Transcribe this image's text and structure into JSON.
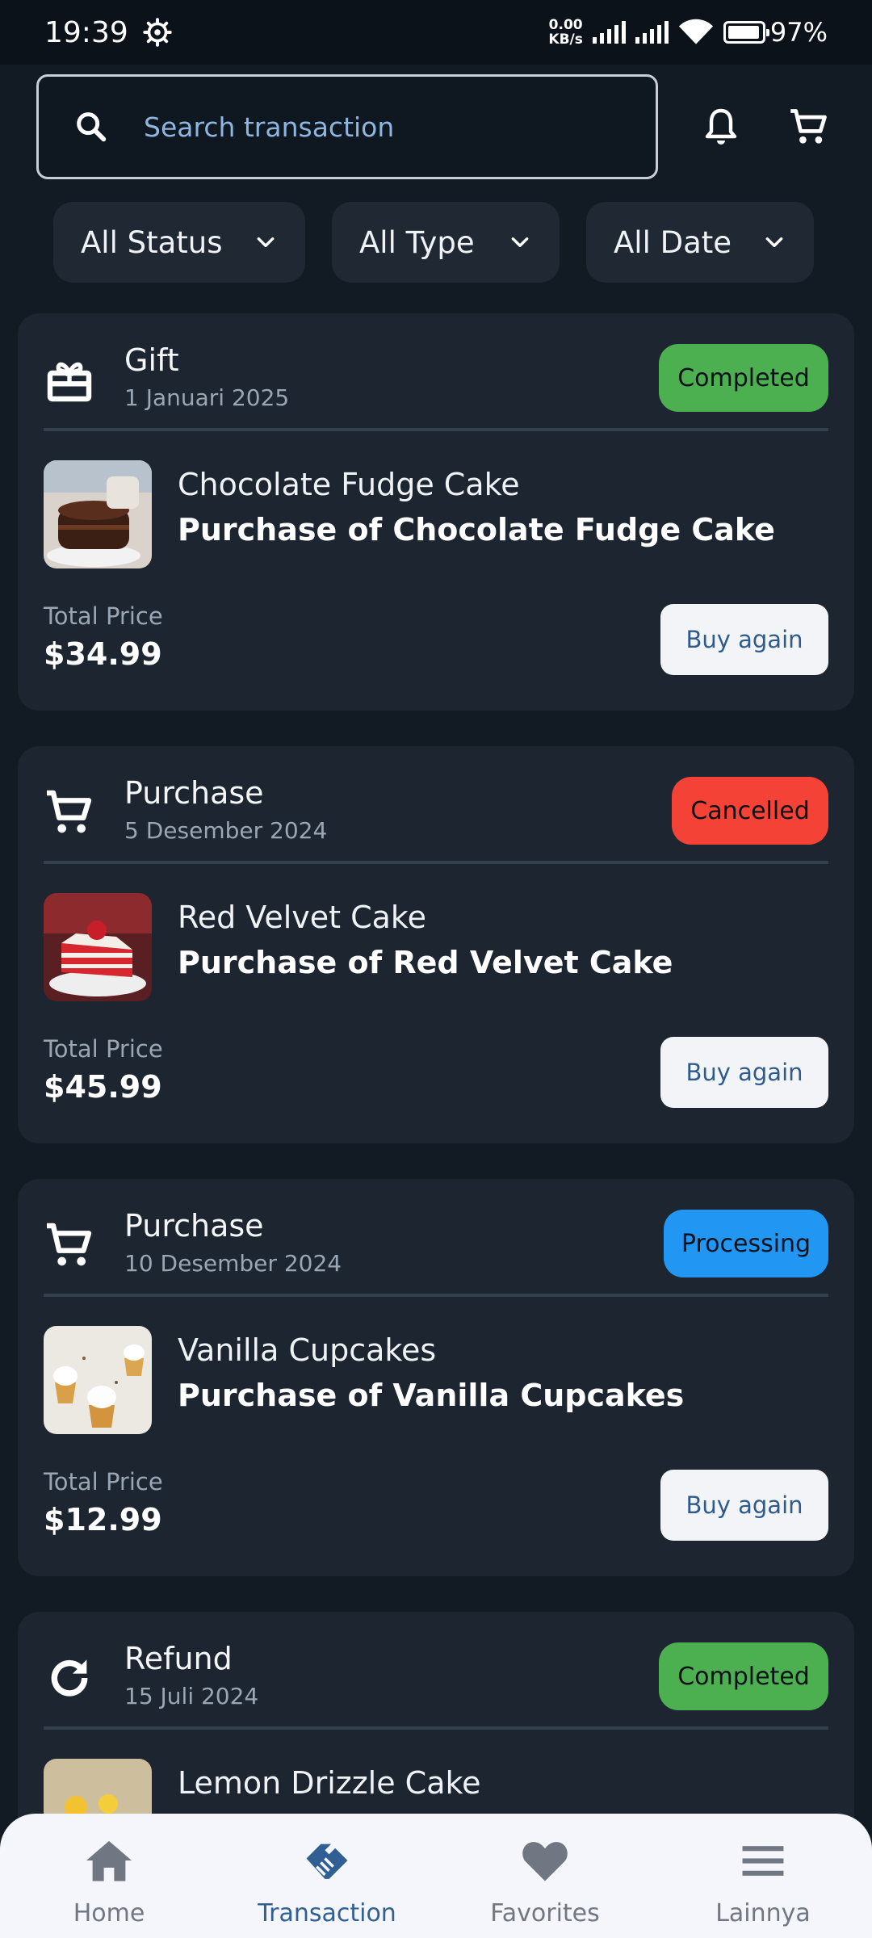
{
  "status_bar": {
    "time": "19:39",
    "net_speed_value": "0.00",
    "net_speed_unit": "KB/s",
    "battery": "97%"
  },
  "search": {
    "placeholder": "Search transaction"
  },
  "filters": [
    {
      "label": "All Status"
    },
    {
      "label": "All Type"
    },
    {
      "label": "All Date"
    }
  ],
  "transactions": [
    {
      "type": "Gift",
      "type_icon": "gift-icon",
      "date": "1 Januari 2025",
      "status": "Completed",
      "status_color": "#4caf50",
      "product_name": "Chocolate Fudge Cake",
      "description": "Purchase of Chocolate Fudge Cake",
      "total_label": "Total Price",
      "total": "$34.99",
      "action": "Buy again"
    },
    {
      "type": "Purchase",
      "type_icon": "cart-icon",
      "date": "5 Desember 2024",
      "status": "Cancelled",
      "status_color": "#f44336",
      "product_name": "Red Velvet Cake",
      "description": "Purchase of Red Velvet Cake",
      "total_label": "Total Price",
      "total": "$45.99",
      "action": "Buy again"
    },
    {
      "type": "Purchase",
      "type_icon": "cart-icon",
      "date": "10 Desember 2024",
      "status": "Processing",
      "status_color": "#2196f3",
      "product_name": "Vanilla Cupcakes",
      "description": "Purchase of Vanilla Cupcakes",
      "total_label": "Total Price",
      "total": "$12.99",
      "action": "Buy again"
    },
    {
      "type": "Refund",
      "type_icon": "refresh-icon",
      "date": "15 Juli 2024",
      "status": "Completed",
      "status_color": "#4caf50",
      "product_name": "Lemon Drizzle Cake"
    }
  ],
  "bottom_nav": [
    {
      "label": "Home",
      "icon": "home-icon"
    },
    {
      "label": "Transaction",
      "icon": "handshake-icon",
      "active": true
    },
    {
      "label": "Favorites",
      "icon": "heart-icon"
    },
    {
      "label": "Lainnya",
      "icon": "menu-icon"
    }
  ]
}
